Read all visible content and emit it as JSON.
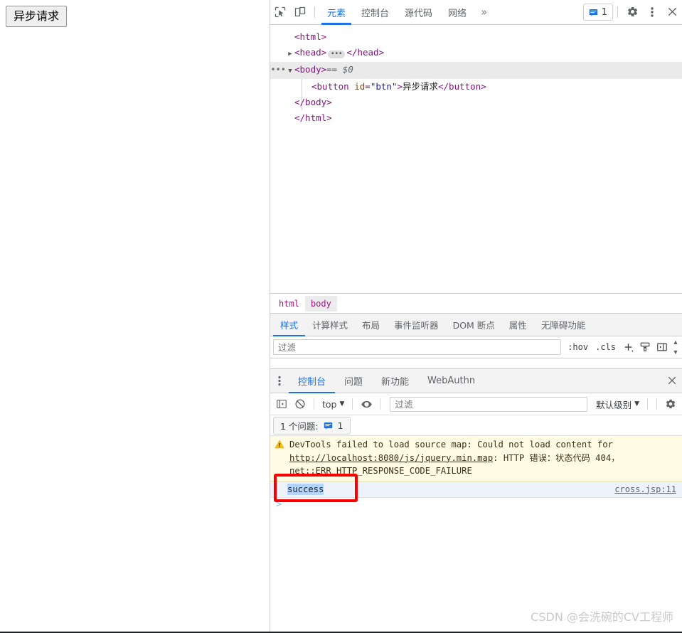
{
  "page": {
    "button_label": "异步请求"
  },
  "devtools": {
    "toolbar": {
      "inspect_icon": "inspect-cursor-icon",
      "device_icon": "device-toolbar-icon",
      "tabs": [
        {
          "label": "元素",
          "active": true
        },
        {
          "label": "控制台",
          "active": false
        },
        {
          "label": "源代码",
          "active": false
        },
        {
          "label": "网络",
          "active": false
        }
      ],
      "overflow_label": "»",
      "issues_count": "1",
      "settings_icon": "gear-icon",
      "more_icon": "kebab-menu-icon",
      "close_icon": "close-icon"
    },
    "dom": {
      "lines": [
        {
          "text": "<html>"
        },
        {
          "text": "<head>…</head>"
        },
        {
          "text": "<body> == $0"
        },
        {
          "text": "<button id=\"btn\">异步请求</button>"
        },
        {
          "text": "</body>"
        },
        {
          "text": "</html>"
        }
      ],
      "html_open": "html",
      "head_tag": "head",
      "body_tag": "body",
      "button_tag": "button",
      "attr_name": "id",
      "attr_value": "\"btn\"",
      "button_text": "异步请求",
      "selected_marker": "== $0",
      "lt": "<",
      "gt": ">",
      "close_slash": "</"
    },
    "breadcrumb": {
      "items": [
        {
          "label": "html",
          "active": false
        },
        {
          "label": "body",
          "active": true
        }
      ]
    },
    "styles": {
      "tabs": [
        {
          "label": "样式",
          "active": true
        },
        {
          "label": "计算样式",
          "active": false
        },
        {
          "label": "布局",
          "active": false
        },
        {
          "label": "事件监听器",
          "active": false
        },
        {
          "label": "DOM 断点",
          "active": false
        },
        {
          "label": "属性",
          "active": false
        },
        {
          "label": "无障碍功能",
          "active": false
        }
      ],
      "filter_placeholder": "过滤",
      "filter_value": "",
      "hov_label": ":hov",
      "cls_label": ".cls",
      "new_rule_icon": "plus-icon",
      "copy_styles_icon": "paintbrush-icon",
      "toggle_sidebar_icon": "panel-toggle-icon",
      "scroll_up_icon": "chevron-up-icon",
      "scroll_down_icon": "chevron-down-icon"
    },
    "drawer": {
      "kebab_icon": "kebab-menu-icon",
      "tabs": [
        {
          "label": "控制台",
          "active": true
        },
        {
          "label": "问题",
          "active": false
        },
        {
          "label": "新功能",
          "active": false
        },
        {
          "label": "WebAuthn",
          "active": false
        }
      ],
      "close_icon": "close-icon",
      "toolbar": {
        "sidebar_icon": "console-sidebar-icon",
        "clear_icon": "clear-console-icon",
        "context_label": "top",
        "context_caret": "▼",
        "eye_icon": "live-expression-eye-icon",
        "filter_placeholder": "过滤",
        "filter_value": "",
        "level_label": "默认级别",
        "level_caret": "▼",
        "settings_icon": "gear-icon"
      },
      "issues_bar": {
        "label": "1 个问题:",
        "icon": "issues-message-icon",
        "count": "1"
      },
      "messages": [
        {
          "type": "warning",
          "icon": "warning-triangle-icon",
          "part1": "DevTools failed to load source map: Could not load content for ",
          "link": "http://localhost:8080/js/jquery.min.map",
          "part2": ": HTTP 错误：状态代码 404，net::ERR_HTTP_RESPONSE_CODE_FAILURE"
        },
        {
          "type": "log",
          "text": "success",
          "source": "cross.jsp:11"
        }
      ],
      "prompt_caret": ">"
    }
  },
  "watermark": {
    "text": "CSDN @会洗碗的CV工程师"
  },
  "colors": {
    "accent_blue": "#1a73e8",
    "warning_bg": "#fffbe5",
    "log_bg": "#eef3fb",
    "selection_blue": "#b3d4fc",
    "annotation_red": "#f80000",
    "tag_purple": "#881280",
    "attr_orange": "#994500",
    "value_blue": "#1a1aa6"
  }
}
